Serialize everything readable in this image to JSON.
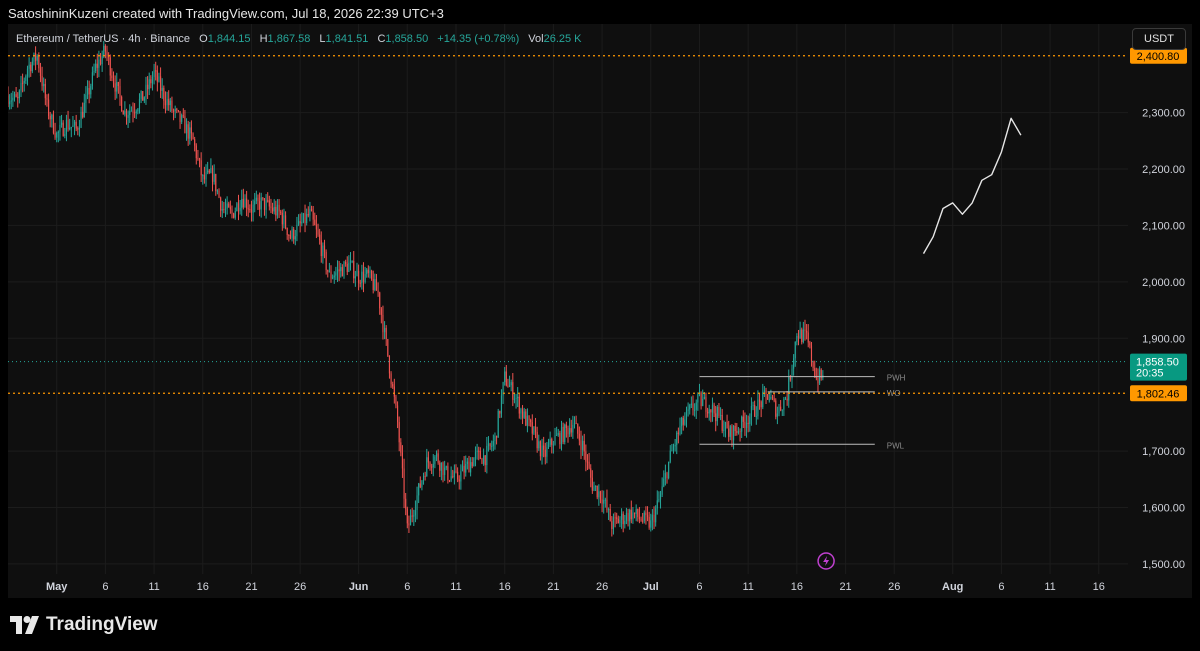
{
  "header": {
    "caption": "SatoshininKuzeni created with TradingView.com, Jul 18, 2026 22:39 UTC+3"
  },
  "legend": {
    "symbol": "Ethereum / TetherUS · 4h · Binance",
    "open_label": "O",
    "open": "1,844.15",
    "high_label": "H",
    "high": "1,867.58",
    "low_label": "L",
    "low": "1,841.51",
    "close_label": "C",
    "close": "1,858.50",
    "change": "+14.35 (+0.78%)",
    "vol_label": "Vol",
    "vol": "26.25 K"
  },
  "toolbar": {
    "currency": "USDT"
  },
  "footer": {
    "brand": "TradingView"
  },
  "colors": {
    "up": "#26a69a",
    "down": "#ef5350",
    "level": "#ff9800",
    "grid": "#1c1c1c",
    "axis_text": "#d1d4dc",
    "last_price_bg": "#089981"
  },
  "chart_data": {
    "type": "candlestick",
    "timeframe": "4h",
    "ylim": [
      1475,
      2450
    ],
    "xlim": [
      "2026-04-26",
      "2026-08-19"
    ],
    "y_ticks": [
      "2,300.00",
      "2,200.00",
      "2,100.00",
      "2,000.00",
      "1,900.00",
      "1,700.00",
      "1,600.00",
      "1,500.00"
    ],
    "x_ticks": [
      {
        "date": "2026-05-01",
        "label": "May",
        "bold": true
      },
      {
        "date": "2026-05-06",
        "label": "6"
      },
      {
        "date": "2026-05-11",
        "label": "11"
      },
      {
        "date": "2026-05-16",
        "label": "16"
      },
      {
        "date": "2026-05-21",
        "label": "21"
      },
      {
        "date": "2026-05-26",
        "label": "26"
      },
      {
        "date": "2026-06-01",
        "label": "Jun",
        "bold": true
      },
      {
        "date": "2026-06-06",
        "label": "6"
      },
      {
        "date": "2026-06-11",
        "label": "11"
      },
      {
        "date": "2026-06-16",
        "label": "16"
      },
      {
        "date": "2026-06-21",
        "label": "21"
      },
      {
        "date": "2026-06-26",
        "label": "26"
      },
      {
        "date": "2026-07-01",
        "label": "Jul",
        "bold": true
      },
      {
        "date": "2026-07-06",
        "label": "6"
      },
      {
        "date": "2026-07-11",
        "label": "11"
      },
      {
        "date": "2026-07-16",
        "label": "16"
      },
      {
        "date": "2026-07-21",
        "label": "21"
      },
      {
        "date": "2026-07-26",
        "label": "26"
      },
      {
        "date": "2026-08-01",
        "label": "Aug",
        "bold": true
      },
      {
        "date": "2026-08-06",
        "label": "6"
      },
      {
        "date": "2026-08-11",
        "label": "11"
      },
      {
        "date": "2026-08-16",
        "label": "16"
      }
    ],
    "price_path": [
      [
        "2026-04-26",
        2330
      ],
      [
        "2026-04-27",
        2320
      ],
      [
        "2026-04-28",
        2380
      ],
      [
        "2026-04-29",
        2400
      ],
      [
        "2026-04-30",
        2310
      ],
      [
        "2026-05-01",
        2260
      ],
      [
        "2026-05-02",
        2280
      ],
      [
        "2026-05-03",
        2270
      ],
      [
        "2026-05-04",
        2320
      ],
      [
        "2026-05-05",
        2380
      ],
      [
        "2026-05-06",
        2410
      ],
      [
        "2026-05-07",
        2350
      ],
      [
        "2026-05-08",
        2300
      ],
      [
        "2026-05-09",
        2310
      ],
      [
        "2026-05-10",
        2330
      ],
      [
        "2026-05-11",
        2370
      ],
      [
        "2026-05-12",
        2330
      ],
      [
        "2026-05-13",
        2300
      ],
      [
        "2026-05-14",
        2280
      ],
      [
        "2026-05-15",
        2250
      ],
      [
        "2026-05-16",
        2180
      ],
      [
        "2026-05-17",
        2190
      ],
      [
        "2026-05-18",
        2130
      ],
      [
        "2026-05-19",
        2120
      ],
      [
        "2026-05-20",
        2150
      ],
      [
        "2026-05-21",
        2130
      ],
      [
        "2026-05-22",
        2140
      ],
      [
        "2026-05-23",
        2130
      ],
      [
        "2026-05-24",
        2120
      ],
      [
        "2026-05-25",
        2080
      ],
      [
        "2026-05-26",
        2100
      ],
      [
        "2026-05-27",
        2120
      ],
      [
        "2026-05-28",
        2070
      ],
      [
        "2026-05-29",
        2010
      ],
      [
        "2026-05-30",
        2020
      ],
      [
        "2026-05-31",
        2030
      ],
      [
        "2026-06-01",
        2010
      ],
      [
        "2026-06-02",
        2010
      ],
      [
        "2026-06-03",
        1980
      ],
      [
        "2026-06-04",
        1870
      ],
      [
        "2026-06-05",
        1750
      ],
      [
        "2026-06-06",
        1560
      ],
      [
        "2026-06-07",
        1620
      ],
      [
        "2026-06-08",
        1680
      ],
      [
        "2026-06-09",
        1690
      ],
      [
        "2026-06-10",
        1660
      ],
      [
        "2026-06-11",
        1650
      ],
      [
        "2026-06-12",
        1670
      ],
      [
        "2026-06-13",
        1690
      ],
      [
        "2026-06-14",
        1690
      ],
      [
        "2026-06-15",
        1720
      ],
      [
        "2026-06-16",
        1830
      ],
      [
        "2026-06-17",
        1800
      ],
      [
        "2026-06-18",
        1760
      ],
      [
        "2026-06-19",
        1730
      ],
      [
        "2026-06-20",
        1690
      ],
      [
        "2026-06-21",
        1720
      ],
      [
        "2026-06-22",
        1730
      ],
      [
        "2026-06-23",
        1750
      ],
      [
        "2026-06-24",
        1710
      ],
      [
        "2026-06-25",
        1640
      ],
      [
        "2026-06-26",
        1620
      ],
      [
        "2026-06-27",
        1570
      ],
      [
        "2026-06-28",
        1580
      ],
      [
        "2026-06-29",
        1590
      ],
      [
        "2026-06-30",
        1580
      ],
      [
        "2026-07-01",
        1570
      ],
      [
        "2026-07-02",
        1620
      ],
      [
        "2026-07-03",
        1690
      ],
      [
        "2026-07-04",
        1740
      ],
      [
        "2026-07-05",
        1770
      ],
      [
        "2026-07-06",
        1790
      ],
      [
        "2026-07-07",
        1780
      ],
      [
        "2026-07-08",
        1760
      ],
      [
        "2026-07-09",
        1730
      ],
      [
        "2026-07-10",
        1740
      ],
      [
        "2026-07-11",
        1760
      ],
      [
        "2026-07-12",
        1780
      ],
      [
        "2026-07-13",
        1800
      ],
      [
        "2026-07-14",
        1770
      ],
      [
        "2026-07-15",
        1800
      ],
      [
        "2026-07-16",
        1910
      ],
      [
        "2026-07-17",
        1900
      ],
      [
        "2026-07-18",
        1830
      ],
      [
        "2026-07-18",
        1858
      ]
    ],
    "h_levels": [
      {
        "value": 2400.8,
        "label": "2,400.80",
        "style": "dotted-orange"
      },
      {
        "value": 1802.46,
        "label": "1,802.46",
        "style": "dotted-orange"
      }
    ],
    "last_price": {
      "value": 1858.5,
      "label": "1,858.50",
      "countdown": "20:35"
    },
    "marked_levels": [
      {
        "label": "PWH",
        "value": 1832,
        "from": "2026-07-06",
        "to": "2026-07-24"
      },
      {
        "label": "WO",
        "value": 1805,
        "from": "2026-07-13",
        "to": "2026-07-24"
      },
      {
        "label": "PWL",
        "value": 1712,
        "from": "2026-07-06",
        "to": "2026-07-24"
      }
    ],
    "projection_path": [
      [
        "2026-07-29",
        2050
      ],
      [
        "2026-07-30",
        2080
      ],
      [
        "2026-07-31",
        2130
      ],
      [
        "2026-08-01",
        2140
      ],
      [
        "2026-08-02",
        2120
      ],
      [
        "2026-08-03",
        2140
      ],
      [
        "2026-08-04",
        2180
      ],
      [
        "2026-08-05",
        2190
      ],
      [
        "2026-08-06",
        2230
      ],
      [
        "2026-08-07",
        2290
      ],
      [
        "2026-08-08",
        2260
      ]
    ]
  }
}
